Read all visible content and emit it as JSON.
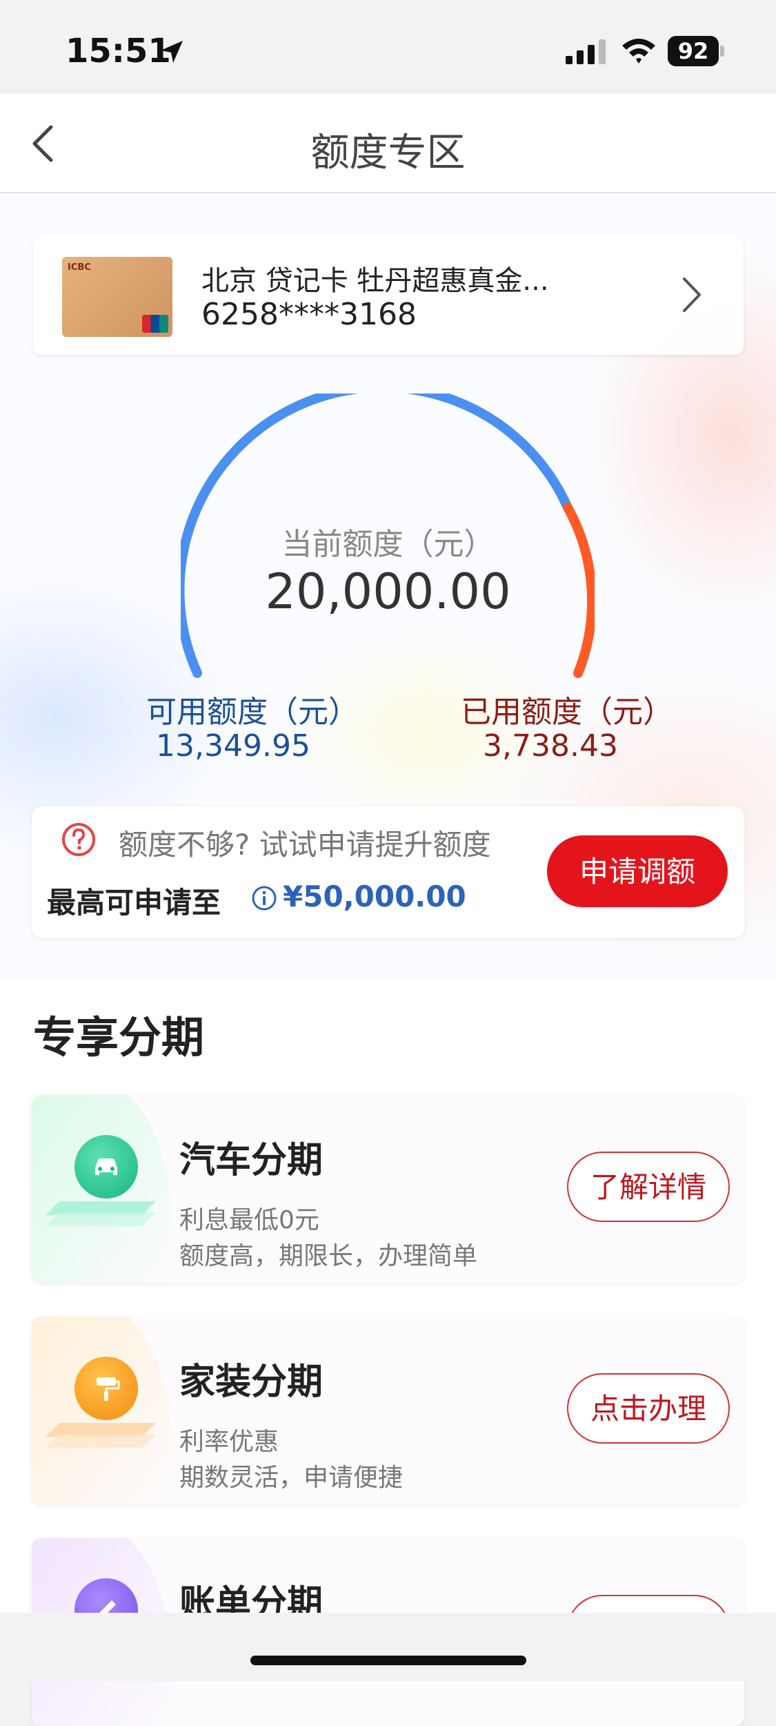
{
  "status_bar": {
    "time": "15:51",
    "battery": "92"
  },
  "nav": {
    "title": "额度专区"
  },
  "card": {
    "name": "北京 贷记卡 牡丹超惠真金...",
    "number": "6258****3168"
  },
  "gauge": {
    "label": "当前额度（元）",
    "total": "20,000.00",
    "available_label": "可用额度（元）",
    "available": "13,349.95",
    "used_label": "已用额度（元）",
    "used": "3,738.43",
    "colors": {
      "available": "#4a90f0",
      "used": "#ff5a26"
    }
  },
  "adjust": {
    "tip": "额度不够? 试试申请提升额度",
    "max_label": "最高可申请至",
    "max_value": "¥50,000.00",
    "button": "申请调额"
  },
  "section": {
    "title": "专享分期",
    "items": [
      {
        "title": "汽车分期",
        "desc1": "利息最低0元",
        "desc2": "额度高，期限长，办理简单",
        "button": "了解详情",
        "icon": "car-icon"
      },
      {
        "title": "家装分期",
        "desc1": "利率优惠",
        "desc2": "期数灵活，申请便捷",
        "button": "点击办理",
        "icon": "paint-roller-icon"
      },
      {
        "title": "账单分期",
        "desc1": "",
        "desc2": "",
        "button": "",
        "icon": "pen-icon"
      }
    ]
  }
}
